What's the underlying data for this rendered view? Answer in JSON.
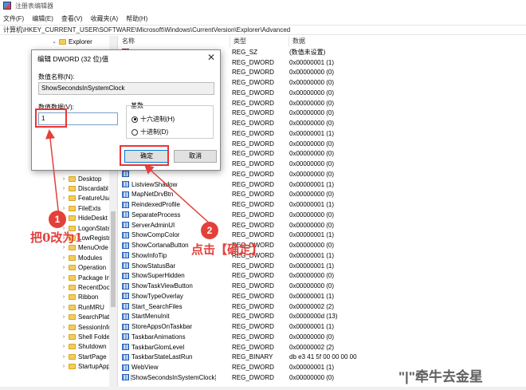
{
  "window": {
    "title": "注册表编辑器"
  },
  "menu": [
    "文件(F)",
    "编辑(E)",
    "查看(V)",
    "收藏夹(A)",
    "帮助(H)"
  ],
  "address": "计算机\\HKEY_CURRENT_USER\\SOFTWARE\\Microsoft\\Windows\\CurrentVersion\\Explorer\\Advanced",
  "tree": {
    "top": "Explorer",
    "items": [
      "Desktop",
      "Discardabl",
      "FeatureUsa",
      "FileExts",
      "HideDeskt",
      "LogonStats",
      "LowRegistr",
      "MenuOrde",
      "Modules",
      "Operation",
      "Package In",
      "RecentDoc",
      "Ribbon",
      "RunMRU",
      "SearchPlatf",
      "SessionInfo",
      "Shell Folde",
      "Shutdown",
      "StartPage",
      "StartupApp"
    ]
  },
  "columns": {
    "name": "名称",
    "type": "类型",
    "data": "数据"
  },
  "rows": [
    {
      "name": "",
      "type": "REG_SZ",
      "data": "(数值未设置)",
      "icon": "ab"
    },
    {
      "name": "",
      "type": "REG_DWORD",
      "data": "0x00000001 (1)"
    },
    {
      "name": "",
      "type": "REG_DWORD",
      "data": "0x00000000 (0)"
    },
    {
      "name": "",
      "type": "REG_DWORD",
      "data": "0x00000000 (0)"
    },
    {
      "name": "",
      "type": "REG_DWORD",
      "data": "0x00000000 (0)"
    },
    {
      "name": "",
      "type": "REG_DWORD",
      "data": "0x00000000 (0)"
    },
    {
      "name": "",
      "type": "REG_DWORD",
      "data": "0x00000000 (0)"
    },
    {
      "name": "",
      "type": "REG_DWORD",
      "data": "0x00000000 (0)"
    },
    {
      "name": "",
      "type": "REG_DWORD",
      "data": "0x00000001 (1)"
    },
    {
      "name": "",
      "type": "REG_DWORD",
      "data": "0x00000000 (0)"
    },
    {
      "name": "",
      "type": "REG_DWORD",
      "data": "0x00000000 (0)"
    },
    {
      "name": "",
      "type": "REG_DWORD",
      "data": "0x00000000 (0)"
    },
    {
      "name": "",
      "type": "REG_DWORD",
      "data": "0x00000000 (0)"
    },
    {
      "name": "ListviewShadow",
      "type": "REG_DWORD",
      "data": "0x00000001 (1)"
    },
    {
      "name": "MapNetDrvBtn",
      "type": "REG_DWORD",
      "data": "0x00000000 (0)"
    },
    {
      "name": "ReindexedProfile",
      "type": "REG_DWORD",
      "data": "0x00000001 (1)"
    },
    {
      "name": "SeparateProcess",
      "type": "REG_DWORD",
      "data": "0x00000000 (0)"
    },
    {
      "name": "ServerAdminUI",
      "type": "REG_DWORD",
      "data": "0x00000000 (0)"
    },
    {
      "name": "ShowCompColor",
      "type": "REG_DWORD",
      "data": "0x00000001 (1)"
    },
    {
      "name": "ShowCortanaButton",
      "type": "REG_DWORD",
      "data": "0x00000000 (0)"
    },
    {
      "name": "ShowInfoTip",
      "type": "REG_DWORD",
      "data": "0x00000001 (1)"
    },
    {
      "name": "ShowStatusBar",
      "type": "REG_DWORD",
      "data": "0x00000001 (1)"
    },
    {
      "name": "ShowSuperHidden",
      "type": "REG_DWORD",
      "data": "0x00000000 (0)"
    },
    {
      "name": "ShowTaskViewButton",
      "type": "REG_DWORD",
      "data": "0x00000000 (0)"
    },
    {
      "name": "ShowTypeOverlay",
      "type": "REG_DWORD",
      "data": "0x00000001 (1)"
    },
    {
      "name": "Start_SearchFiles",
      "type": "REG_DWORD",
      "data": "0x00000002 (2)"
    },
    {
      "name": "StartMenuInit",
      "type": "REG_DWORD",
      "data": "0x0000000d (13)"
    },
    {
      "name": "StoreAppsOnTaskbar",
      "type": "REG_DWORD",
      "data": "0x00000001 (1)"
    },
    {
      "name": "TaskbarAnimations",
      "type": "REG_DWORD",
      "data": "0x00000000 (0)"
    },
    {
      "name": "TaskbarGlomLevel",
      "type": "REG_DWORD",
      "data": "0x00000002 (2)"
    },
    {
      "name": "TaskbarStateLastRun",
      "type": "REG_BINARY",
      "data": "db e3 41 5f 00 00 00 00"
    },
    {
      "name": "WebView",
      "type": "REG_DWORD",
      "data": "0x00000001 (1)"
    },
    {
      "name": "ShowSecondsInSystemClock",
      "type": "REG_DWORD",
      "data": "0x00000000 (0)"
    }
  ],
  "dialog": {
    "title": "编辑 DWORD (32 位)值",
    "name_label": "数值名称(N):",
    "name_value": "ShowSecondsInSystemClock",
    "value_label": "数值数据(V):",
    "value": "1",
    "base_label": "基数",
    "hex_label": "十六进制(H)",
    "dec_label": "十进制(D)",
    "ok_label": "确定",
    "cancel_label": "取消"
  },
  "annotations": {
    "step1_num": "1",
    "step1_text": "把0改为1",
    "step2_num": "2",
    "step2_text": "点击【确定】",
    "accent": "#e3403b"
  },
  "watermark": "\"|\"牵牛去金星"
}
